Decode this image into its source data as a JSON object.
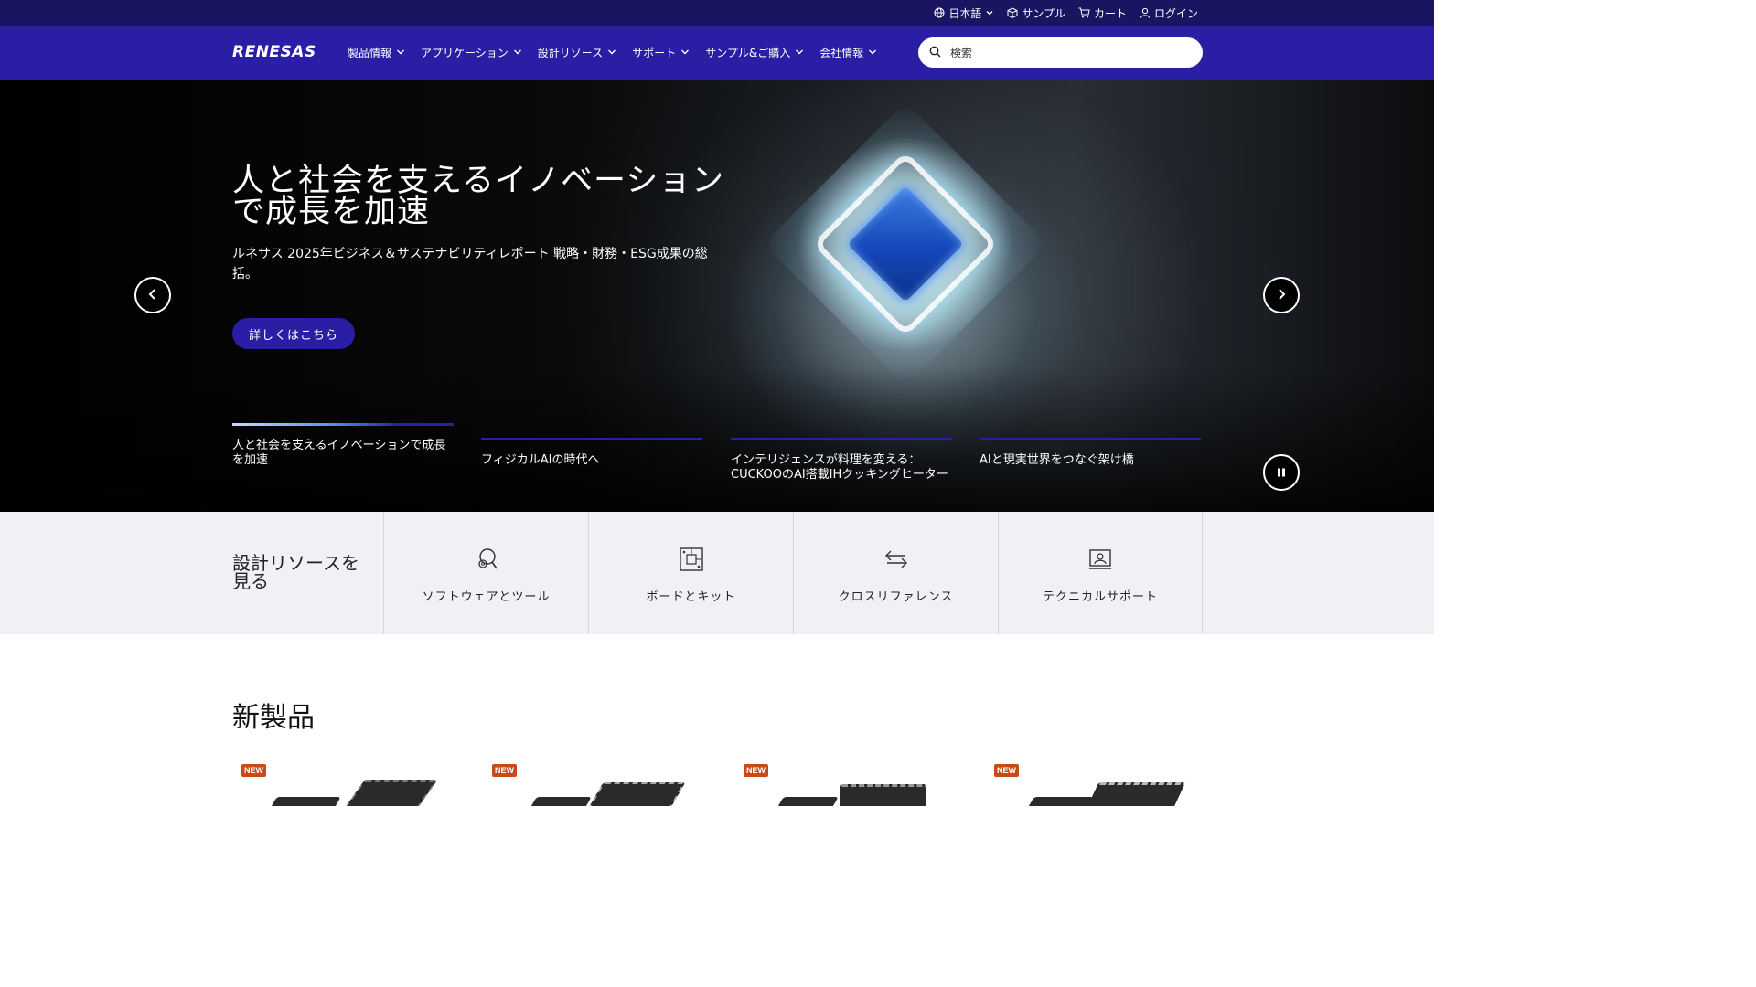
{
  "utility": {
    "language": "日本語",
    "sample": "サンプル",
    "cart": "カート",
    "login": "ログイン"
  },
  "nav": {
    "logo": "RENESAS",
    "items": [
      {
        "label": "製品情報"
      },
      {
        "label": "アプリケーション"
      },
      {
        "label": "設計リソース"
      },
      {
        "label": "サポート"
      },
      {
        "label": "サンプル&ご購入"
      },
      {
        "label": "会社情報"
      }
    ],
    "search_placeholder": "検索"
  },
  "hero": {
    "title": "人と社会を支えるイノベーションで成長を加速",
    "subtitle": "ルネサス 2025年ビジネス＆サステナビリティレポート 戦略・財務・ESG成果の総括。",
    "cta": "詳しくはこちら",
    "slides": [
      {
        "label": "人と社会を支えるイノベーションで成長を加速",
        "active": true
      },
      {
        "label": "フィジカルAIの時代へ",
        "active": false
      },
      {
        "label": "インテリジェンスが料理を変える：CUCKOOのAI搭載IHクッキングヒーター",
        "active": false
      },
      {
        "label": "AIと現実世界をつなぐ架け橋",
        "active": false
      }
    ]
  },
  "resources": {
    "title": "設計リソースを見る",
    "cards": [
      {
        "label": "ソフトウェアとツール",
        "icon": "software-tools-icon"
      },
      {
        "label": "ボードとキット",
        "icon": "board-kit-icon"
      },
      {
        "label": "クロスリファレンス",
        "icon": "cross-reference-icon"
      },
      {
        "label": "テクニカルサポート",
        "icon": "technical-support-icon"
      }
    ]
  },
  "new_products": {
    "title": "新製品",
    "badge": "NEW"
  },
  "colors": {
    "utility_bar": "#1a1560",
    "nav_bar": "#2a1ea5",
    "new_badge": "#c84a16"
  }
}
